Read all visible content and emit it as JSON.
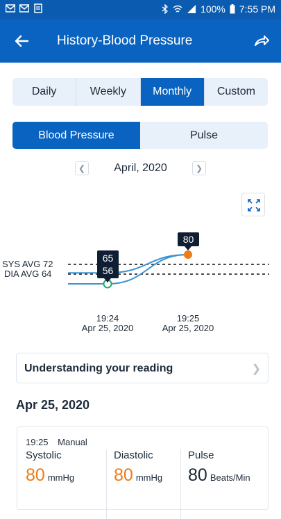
{
  "status_bar": {
    "left_icons": [
      "gmail-icon",
      "gmail-icon",
      "document-icon"
    ],
    "right_icons": [
      "bluetooth-icon",
      "wifi-icon",
      "signal-icon",
      "battery-icon"
    ],
    "battery": "100%",
    "time": "7:55 PM"
  },
  "header": {
    "title": "History-Blood Pressure",
    "back_icon": "arrow-left-icon",
    "share_icon": "share-icon",
    "accent": "#0a63c0"
  },
  "period_tabs": [
    {
      "label": "Daily",
      "active": false
    },
    {
      "label": "Weekly",
      "active": false
    },
    {
      "label": "Monthly",
      "active": true
    },
    {
      "label": "Custom",
      "active": false
    }
  ],
  "metric_tabs": [
    {
      "label": "Blood Pressure",
      "active": true
    },
    {
      "label": "Pulse",
      "active": false
    }
  ],
  "month_nav": {
    "label": "April, 2020",
    "prev_icon": "chevron-left-icon",
    "next_icon": "chevron-right-icon"
  },
  "expand_icon": "expand-icon",
  "chart_data": {
    "type": "line",
    "x": [
      "19:24\nApr 25, 2020",
      "19:25\nApr 25, 2020"
    ],
    "x_ticks": [
      {
        "time": "19:24",
        "date": "Apr 25, 2020"
      },
      {
        "time": "19:25",
        "date": "Apr 25, 2020"
      }
    ],
    "avg_lines": [
      {
        "label": "SYS AVG 72",
        "value": 72
      },
      {
        "label": "DIA AVG 64",
        "value": 64
      }
    ],
    "series": [
      {
        "values": [
          65,
          80
        ],
        "color": "#3a93d1"
      },
      {
        "values": [
          56,
          80
        ],
        "color": "#3a93d1"
      }
    ],
    "tooltips": [
      {
        "values": [
          "65",
          "56"
        ]
      },
      {
        "values": [
          "80"
        ]
      }
    ],
    "marker_colors": {
      "diastolic": "#2aa66a",
      "systolic": "#ef7c14"
    },
    "grid": false
  },
  "understanding": {
    "label": "Understanding your reading",
    "chevron_icon": "chevron-right-icon"
  },
  "entries": [
    {
      "date": "Apr 25, 2020",
      "time": "19:25",
      "mode": "Manual",
      "systolic": {
        "label": "Systolic",
        "value": "80",
        "unit": "mmHg"
      },
      "diastolic": {
        "label": "Diastolic",
        "value": "80",
        "unit": "mmHg"
      },
      "pulse": {
        "label": "Pulse",
        "value": "80",
        "unit": "Beats/Min"
      }
    }
  ]
}
